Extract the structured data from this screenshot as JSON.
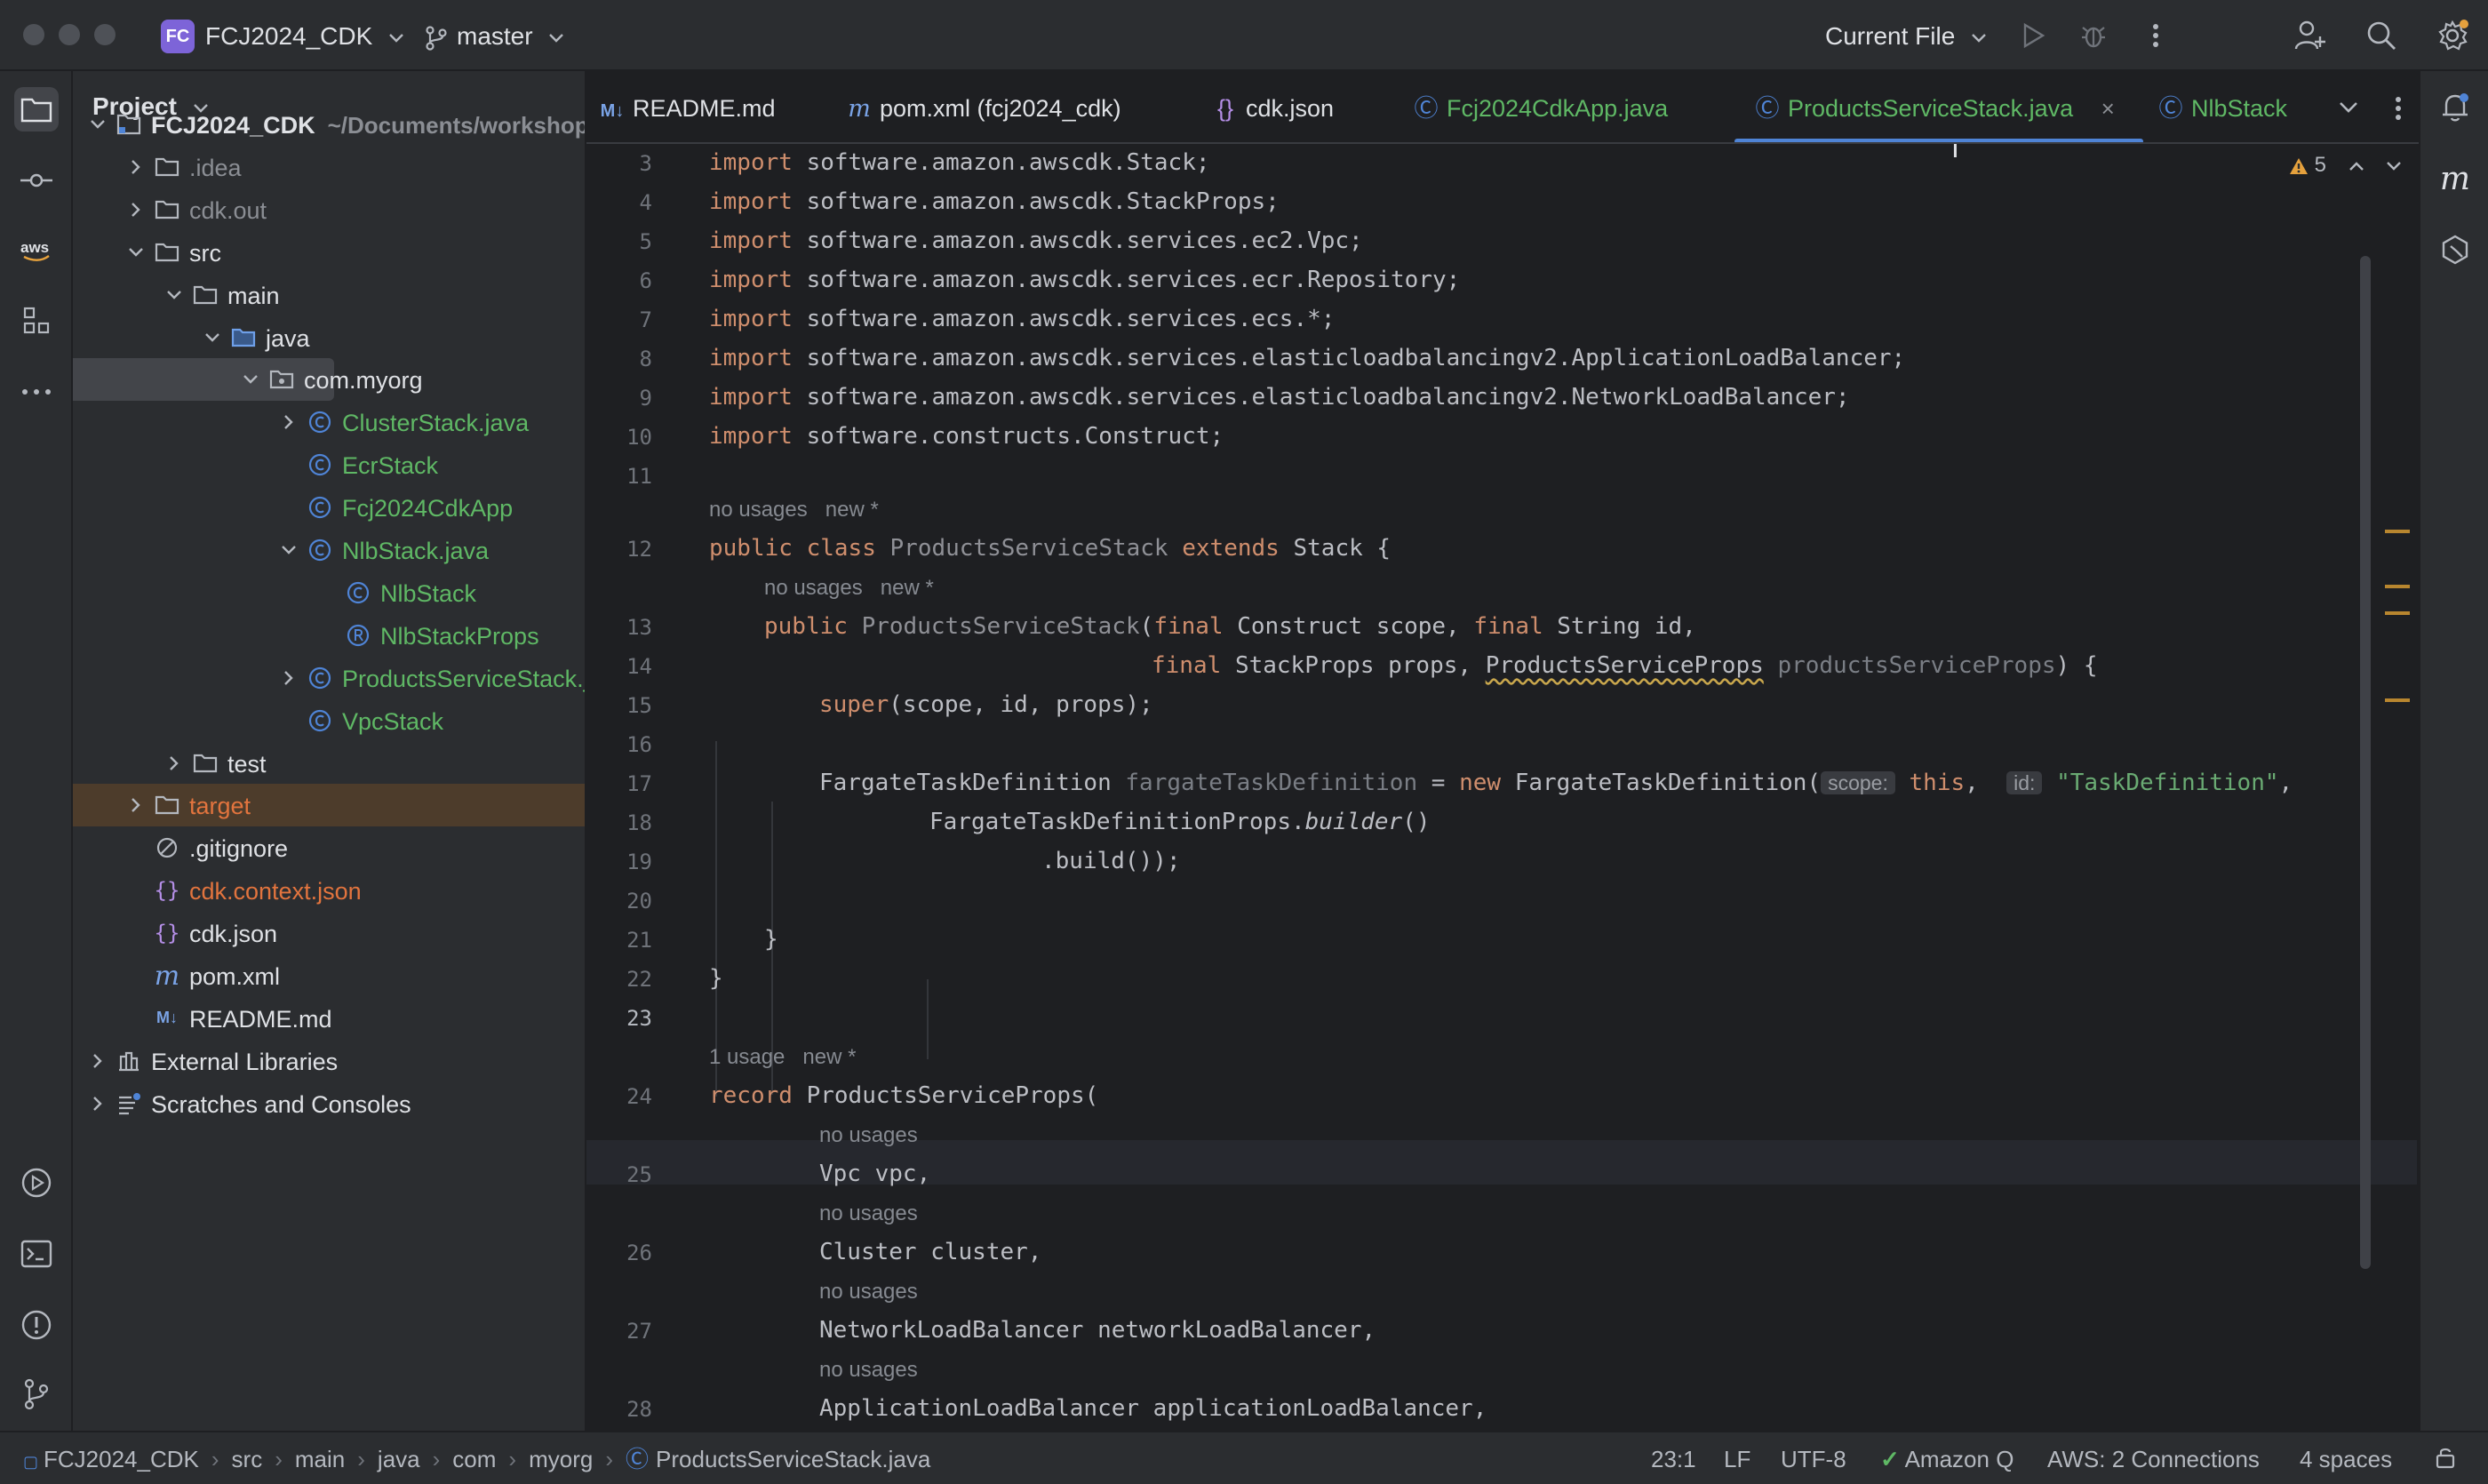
{
  "titlebar": {
    "project_badge": "FC",
    "project_name": "FCJ2024_CDK",
    "branch": "master",
    "run_config": "Current File"
  },
  "project_panel": {
    "title": "Project",
    "tree": [
      {
        "label": "FCJ2024_CDK",
        "sub": "~/Documents/workshop",
        "kind": "module",
        "expanded": true
      },
      {
        "label": ".idea",
        "kind": "folder"
      },
      {
        "label": "cdk.out",
        "kind": "folder"
      },
      {
        "label": "src",
        "kind": "folder"
      },
      {
        "label": "main",
        "kind": "folder"
      },
      {
        "label": "java",
        "kind": "source-folder"
      },
      {
        "label": "com.myorg",
        "kind": "package"
      },
      {
        "label": "ClusterStack.java",
        "kind": "class"
      },
      {
        "label": "EcrStack",
        "kind": "class"
      },
      {
        "label": "Fcj2024CdkApp",
        "kind": "class"
      },
      {
        "label": "NlbStack.java",
        "kind": "class"
      },
      {
        "label": "NlbStack",
        "kind": "class"
      },
      {
        "label": "NlbStackProps",
        "kind": "record"
      },
      {
        "label": "ProductsServiceStack.java",
        "kind": "class"
      },
      {
        "label": "VpcStack",
        "kind": "class"
      },
      {
        "label": "test",
        "kind": "folder"
      },
      {
        "label": "target",
        "kind": "folder"
      },
      {
        "label": ".gitignore",
        "kind": "ignore"
      },
      {
        "label": "cdk.context.json",
        "kind": "json"
      },
      {
        "label": "cdk.json",
        "kind": "json"
      },
      {
        "label": "pom.xml",
        "kind": "maven"
      },
      {
        "label": "README.md",
        "kind": "markdown"
      },
      {
        "label": "External Libraries",
        "kind": "library"
      },
      {
        "label": "Scratches and Consoles",
        "kind": "scratches"
      }
    ]
  },
  "tabs": [
    {
      "label": "README.md",
      "icon": "markdown-icon"
    },
    {
      "label": "pom.xml (fcj2024_cdk)",
      "icon": "maven-icon"
    },
    {
      "label": "cdk.json",
      "icon": "json-icon"
    },
    {
      "label": "Fcj2024CdkApp.java",
      "icon": "class-icon"
    },
    {
      "label": "ProductsServiceStack.java",
      "icon": "class-icon",
      "active": true
    },
    {
      "label": "NlbStack",
      "icon": "class-icon"
    }
  ],
  "editor": {
    "warning_count": "5",
    "line_numbers": [
      "3",
      "4",
      "5",
      "6",
      "7",
      "8",
      "9",
      "10",
      "11",
      "12",
      "13",
      "14",
      "15",
      "16",
      "17",
      "18",
      "19",
      "20",
      "21",
      "22",
      "23",
      "24",
      "25",
      "26",
      "27",
      "28"
    ],
    "imports": [
      "software.amazon.awscdk.Stack;",
      "software.amazon.awscdk.StackProps;",
      "software.amazon.awscdk.services.ec2.Vpc;",
      "software.amazon.awscdk.services.ecr.Repository;",
      "software.amazon.awscdk.services.ecs.*;",
      "software.amazon.awscdk.services.elasticloadbalancingv2.ApplicationLoadBalancer;",
      "software.amazon.awscdk.services.elasticloadbalancingv2.NetworkLoadBalancer;",
      "software.constructs.Construct;"
    ],
    "kw_import": "import",
    "kw_public": "public",
    "kw_class": "class",
    "kw_extends": "extends",
    "kw_final": "final",
    "kw_super": "super",
    "kw_new": "new",
    "kw_this": "this",
    "kw_record": "record",
    "inlay_no_usages": "no usages",
    "inlay_new": "new *",
    "inlay_1_usage": "1 usage",
    "class_name": "ProductsServiceStack",
    "stack": "Stack {",
    "ctor_params_1": "(final Construct scope, final String id,",
    "ctor_construct": "Construct scope,",
    "ctor_string": "String id,",
    "ctor_line2_a": "StackProps props,",
    "ctor_line2_type": "ProductsServiceProps",
    "ctor_line2_param": "productsServiceProps",
    "ctor_line2_end": ") {",
    "super_args": "(scope, id, props);",
    "ftd_type": "FargateTaskDefinition",
    "ftd_var": "fargateTaskDefinition",
    "ftd_eq": "=",
    "ftd_ctor": "FargateTaskDefinition(",
    "hint_scope": "scope:",
    "hint_id": "id:",
    "ftd_str": "\"TaskDefinition\"",
    "builder_cls": "FargateTaskDefinitionProps.",
    "builder_meth": "builder",
    "builder_end": "()",
    "build": ".build());",
    "close_brace": "}",
    "record_name": "ProductsServiceProps(",
    "field_vpc": "Vpc vpc,",
    "field_cluster": "Cluster cluster,",
    "field_nlb": "NetworkLoadBalancer networkLoadBalancer,",
    "field_alb": "ApplicationLoadBalancer applicationLoadBalancer,"
  },
  "statusbar": {
    "breadcrumbs": [
      "FCJ2024_CDK",
      "src",
      "main",
      "java",
      "com",
      "myorg",
      "ProductsServiceStack.java"
    ],
    "position": "23:1",
    "line_sep": "LF",
    "encoding": "UTF-8",
    "amazon_q": "Amazon Q",
    "aws": "AWS: 2 Connections",
    "indent": "4 spaces"
  },
  "colors": {
    "accent": "#4f84d6",
    "keyword": "#cf8e6d",
    "string": "#6aab73",
    "vcs_added": "#5fb865",
    "ignored": "#e2743e"
  }
}
